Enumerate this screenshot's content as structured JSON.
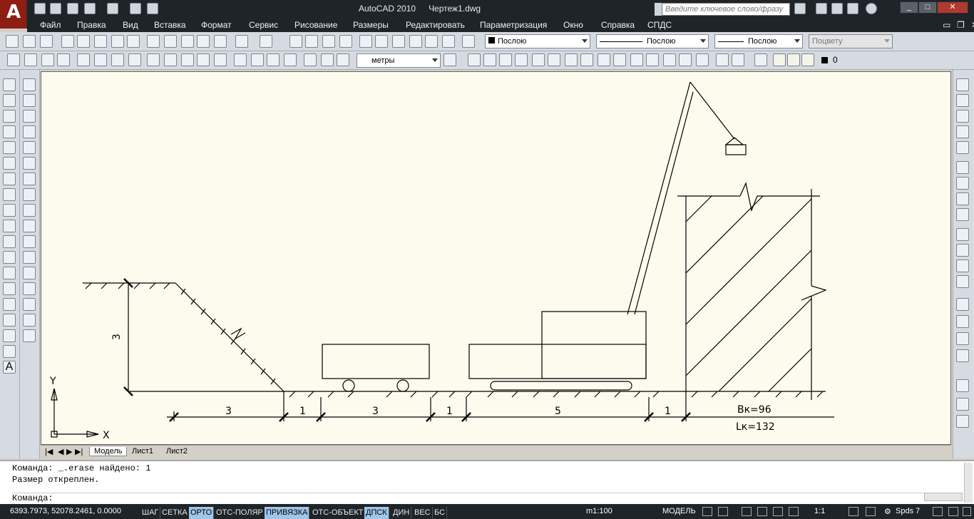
{
  "title": {
    "app": "AutoCAD 2010",
    "document": "Чертеж1.dwg"
  },
  "search": {
    "placeholder": "Введите ключевое слово/фразу"
  },
  "menu": [
    "Файл",
    "Правка",
    "Вид",
    "Вставка",
    "Формат",
    "Сервис",
    "Рисование",
    "Размеры",
    "Редактировать",
    "Параметризация",
    "Окно",
    "Справка",
    "СПДС"
  ],
  "properties": {
    "color": "Послою",
    "linetype": "Послою",
    "lineweight": "Послою",
    "plotstyle": "Поцвету"
  },
  "units_combo": "метры",
  "layer": {
    "name": "0"
  },
  "drawing": {
    "dims": {
      "height": "3",
      "seg1": "3",
      "seg2": "1",
      "seg3": "3",
      "seg4": "1",
      "seg5": "5",
      "seg6": "1"
    },
    "bk_label": "Вк=96",
    "lk_label": "Lк=132",
    "ucs": {
      "y": "Y",
      "x": "X"
    }
  },
  "tabs": [
    "Модель",
    "Лист1",
    "Лист2"
  ],
  "command": {
    "line1": "Команда: _.erase найдено: 1",
    "line2": "Размер откреплен.",
    "prompt": "Команда:"
  },
  "status": {
    "coords": "6393.7973, 52078.2461, 0.0000",
    "toggles": [
      "ШАГ",
      "СЕТКА",
      "ОРТО",
      "ОТС-ПОЛЯР",
      "ПРИВЯЗКА",
      "ОТС-ОБЪЕКТ",
      "ДПСК",
      "ДИН",
      "ВЕС",
      "БС"
    ],
    "toggles_on": [
      "ОРТО",
      "ПРИВЯЗКА",
      "ДПСК"
    ],
    "scale": "m1:100",
    "mode": "МОДЕЛЬ",
    "anno_scale": "1:1",
    "workspace": "Spds 7"
  },
  "colors": {
    "canvas": "#fdfbee",
    "chrome": "#1f2428",
    "toolbar": "#d6dbe2",
    "on": "#9ec6e8"
  }
}
